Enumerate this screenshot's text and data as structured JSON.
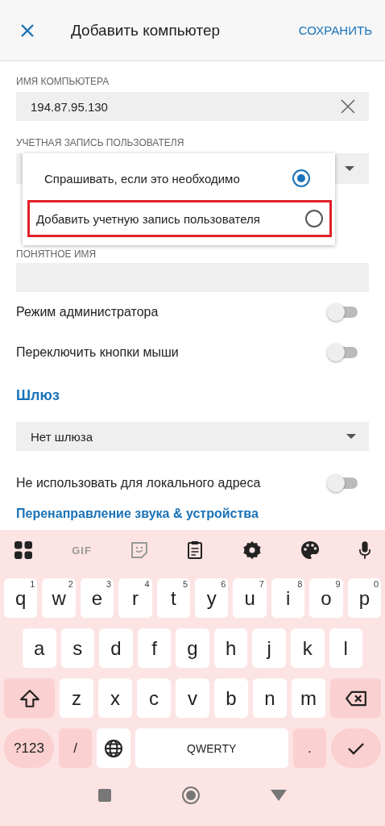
{
  "header": {
    "title": "Добавить компьютер",
    "action": "СОХРАНИТЬ"
  },
  "computer_name": {
    "label": "ИМЯ КОМПЬЮТЕРА",
    "value": "194.87.95.130"
  },
  "user_account": {
    "label": "УЧЕТНАЯ ЗАПИСЬ ПОЛЬЗОВАТЕЛЯ"
  },
  "account_menu": [
    {
      "label": "Спрашивать, если это необходимо",
      "selected": true,
      "highlighted": false
    },
    {
      "label": "Добавить учетную запись пользователя",
      "selected": false,
      "highlighted": true
    }
  ],
  "friendly_name": {
    "label": "ПОНЯТНОЕ ИМЯ"
  },
  "toggles": [
    {
      "label": "Режим администратора",
      "on": false
    },
    {
      "label": "Переключить кнопки мыши",
      "on": false
    }
  ],
  "gateway": {
    "heading": "Шлюз",
    "value": "Нет шлюза"
  },
  "local_toggle": {
    "label": "Не использовать для локального адреса",
    "on": false
  },
  "next_heading": "Перенаправление звука & устройства",
  "keyboard": {
    "toolbar_gif": "GIF",
    "rows": [
      {
        "keys": [
          {
            "kind": "letter",
            "label": "q",
            "hint": "1"
          },
          {
            "kind": "letter",
            "label": "w",
            "hint": "2"
          },
          {
            "kind": "letter",
            "label": "e",
            "hint": "3"
          },
          {
            "kind": "letter",
            "label": "r",
            "hint": "4"
          },
          {
            "kind": "letter",
            "label": "t",
            "hint": "5"
          },
          {
            "kind": "letter",
            "label": "y",
            "hint": "6"
          },
          {
            "kind": "letter",
            "label": "u",
            "hint": "7"
          },
          {
            "kind": "letter",
            "label": "i",
            "hint": "8"
          },
          {
            "kind": "letter",
            "label": "o",
            "hint": "9"
          },
          {
            "kind": "letter",
            "label": "p",
            "hint": "0"
          }
        ]
      },
      {
        "keys": [
          {
            "kind": "letter",
            "label": "a"
          },
          {
            "kind": "letter",
            "label": "s"
          },
          {
            "kind": "letter",
            "label": "d"
          },
          {
            "kind": "letter",
            "label": "f"
          },
          {
            "kind": "letter",
            "label": "g"
          },
          {
            "kind": "letter",
            "label": "h"
          },
          {
            "kind": "letter",
            "label": "j"
          },
          {
            "kind": "letter",
            "label": "k"
          },
          {
            "kind": "letter",
            "label": "l"
          }
        ]
      },
      {
        "keys": [
          {
            "kind": "shift"
          },
          {
            "kind": "letter",
            "label": "z"
          },
          {
            "kind": "letter",
            "label": "x"
          },
          {
            "kind": "letter",
            "label": "c"
          },
          {
            "kind": "letter",
            "label": "v"
          },
          {
            "kind": "letter",
            "label": "b"
          },
          {
            "kind": "letter",
            "label": "n"
          },
          {
            "kind": "letter",
            "label": "m"
          },
          {
            "kind": "backspace"
          }
        ]
      },
      {
        "keys": [
          {
            "kind": "symbols",
            "label": "?123"
          },
          {
            "kind": "function",
            "label": "/"
          },
          {
            "kind": "globe"
          },
          {
            "kind": "space",
            "label": "QWERTY"
          },
          {
            "kind": "function",
            "label": "."
          },
          {
            "kind": "enter"
          }
        ]
      }
    ]
  }
}
